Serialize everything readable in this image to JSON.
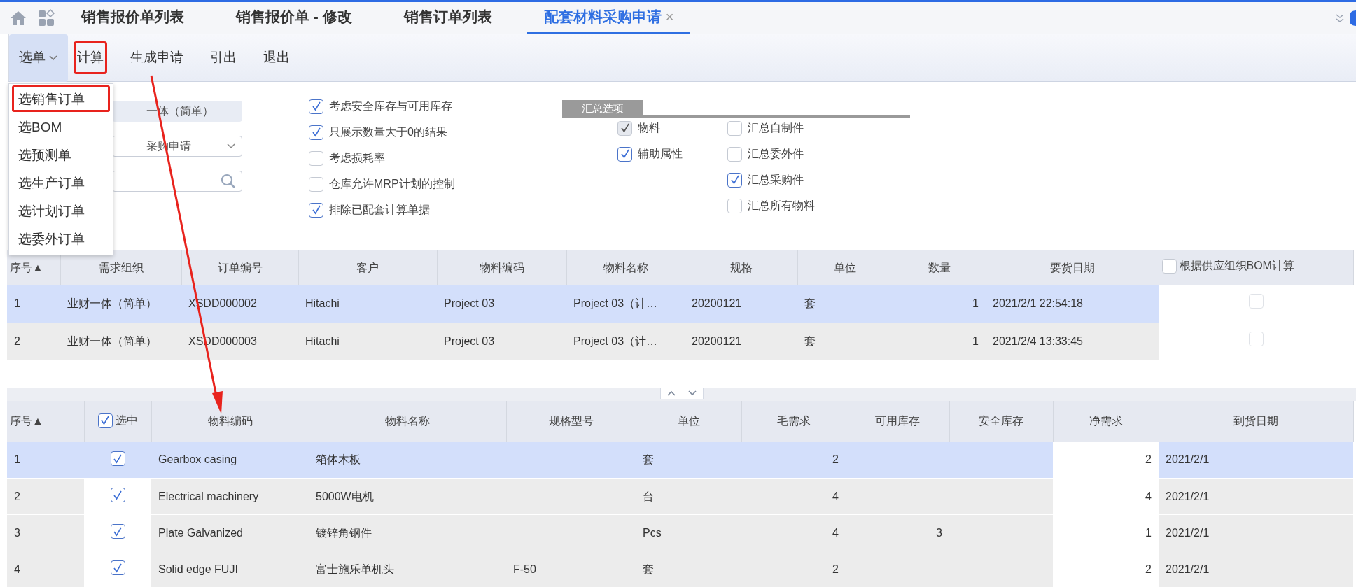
{
  "tabs": [
    {
      "label": "销售报价单列表",
      "selected": false
    },
    {
      "label": "销售报价单 - 修改",
      "selected": false
    },
    {
      "label": "销售订单列表",
      "selected": false
    },
    {
      "label": "配套材料采购申请",
      "selected": true,
      "close": "×"
    }
  ],
  "toolbar": [
    {
      "label": "选单",
      "kind": "dropdown",
      "expanded": true,
      "highlighted": false
    },
    {
      "label": "计算",
      "kind": "button",
      "highlighted": true
    },
    {
      "label": "生成申请",
      "kind": "button",
      "highlighted": false
    },
    {
      "label": "引出",
      "kind": "button",
      "highlighted": false
    },
    {
      "label": "退出",
      "kind": "button",
      "highlighted": false
    }
  ],
  "dropdown_menu": [
    {
      "label": "选销售订单",
      "highlighted": true
    },
    {
      "label": "选BOM",
      "highlighted": false
    },
    {
      "label": "选预测单",
      "highlighted": false
    },
    {
      "label": "选生产订单",
      "highlighted": false
    },
    {
      "label": "选计划订单",
      "highlighted": false
    },
    {
      "label": "选委外订单",
      "highlighted": false
    }
  ],
  "filters": [
    {
      "kind": "text",
      "value": "一体（简单）"
    },
    {
      "kind": "select",
      "value": "采购申请"
    },
    {
      "kind": "search"
    }
  ],
  "options": [
    {
      "label": "考虑安全库存与可用库存",
      "checked": true
    },
    {
      "label": "只展示数量大于0的结果",
      "checked": true
    },
    {
      "label": "考虑损耗率",
      "checked": false
    },
    {
      "label": "仓库允许MRP计划的控制",
      "checked": false
    },
    {
      "label": "排除已配套计算单据",
      "checked": true
    }
  ],
  "summary_options": {
    "title": "汇总选项",
    "left": [
      {
        "label": "物料",
        "checked": true,
        "disabled": true
      },
      {
        "label": "辅助属性",
        "checked": true,
        "disabled": false
      }
    ],
    "right": [
      {
        "label": "汇总自制件",
        "checked": false,
        "disabled": false
      },
      {
        "label": "汇总委外件",
        "checked": false,
        "disabled": false
      },
      {
        "label": "汇总采购件",
        "checked": true,
        "disabled": false
      },
      {
        "label": "汇总所有物料",
        "checked": false,
        "disabled": false
      }
    ]
  },
  "orders_table": {
    "columns": [
      {
        "label": "序号▲"
      },
      {
        "label": "需求组织"
      },
      {
        "label": "订单编号"
      },
      {
        "label": "客户"
      },
      {
        "label": "物料编码"
      },
      {
        "label": "物料名称"
      },
      {
        "label": "规格"
      },
      {
        "label": "单位"
      },
      {
        "label": "数量",
        "kind": "number"
      },
      {
        "label": "要货日期"
      },
      {
        "label": "根据供应组织BOM计算",
        "kind": "check",
        "checked": false
      }
    ],
    "rows": [
      {
        "selected": true,
        "cells": [
          "1",
          "业财一体（简单）",
          "XSDD000002",
          "Hitachi",
          "Project 03",
          "Project 03（计…",
          "20200121",
          "套",
          "1",
          "2021/2/1 22:54:18",
          false
        ]
      },
      {
        "selected": false,
        "cells": [
          "2",
          "业财一体（简单）",
          "XSDD000003",
          "Hitachi",
          "Project 03",
          "Project 03（计…",
          "20200121",
          "套",
          "1",
          "2021/2/4 13:33:45",
          false
        ]
      }
    ]
  },
  "materials_table": {
    "columns": [
      {
        "label": "序号▲"
      },
      {
        "label": "选中",
        "kind": "check",
        "checked": true
      },
      {
        "label": "物料编码"
      },
      {
        "label": "物料名称"
      },
      {
        "label": "规格型号"
      },
      {
        "label": "单位"
      },
      {
        "label": "毛需求",
        "kind": "number"
      },
      {
        "label": "可用库存",
        "kind": "number"
      },
      {
        "label": "安全库存",
        "kind": "number"
      },
      {
        "label": "净需求",
        "kind": "input"
      },
      {
        "label": "到货日期"
      }
    ],
    "rows": [
      {
        "selected": true,
        "cells": [
          "1",
          true,
          "Gearbox casing",
          "箱体木板",
          null,
          "套",
          "2",
          null,
          null,
          "2",
          "2021/2/1"
        ]
      },
      {
        "selected": false,
        "cells": [
          "2",
          true,
          "Electrical machinery",
          "5000W电机",
          null,
          "台",
          "4",
          null,
          null,
          "4",
          "2021/2/1"
        ]
      },
      {
        "selected": false,
        "cells": [
          "3",
          true,
          "Plate Galvanized",
          "镀锌角钢件",
          null,
          "Pcs",
          "4",
          "3",
          null,
          "1",
          "2021/2/1"
        ]
      },
      {
        "selected": false,
        "cells": [
          "4",
          true,
          "Solid edge FUJI",
          "富士施乐单机头",
          "F-50",
          "套",
          "2",
          null,
          null,
          "2",
          "2021/2/1"
        ]
      }
    ]
  }
}
